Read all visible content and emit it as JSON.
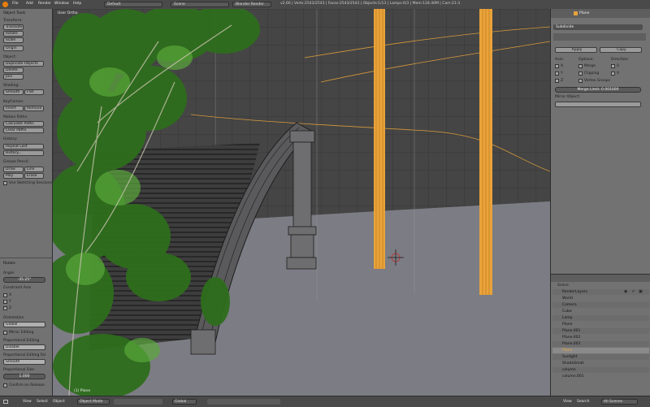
{
  "topbar": {
    "menus": [
      "File",
      "Add",
      "Render",
      "Window",
      "Help"
    ],
    "screen_layout": "Default",
    "scene": "Scene",
    "render_engine": "Blender Render",
    "info": "v2.66 | Verts:2543/2543 | Faces:2543/2543 | Objects:1/13 | Lamps:0/3 | Mem:118.40M | Cam:21:3"
  },
  "toolshelf": {
    "title": "Object Tools",
    "transform_hdr": "Transform:",
    "transform": [
      "Translate",
      "Rotate",
      "Scale",
      "Origin"
    ],
    "object_hdr": "Object:",
    "object": [
      "Duplicate Objects",
      "Delete",
      "Join"
    ],
    "shading_hdr": "Shading:",
    "smooth": "Smooth",
    "flat": "Flat",
    "keyframes_hdr": "Keyframes:",
    "insert": "Insert",
    "remove": "Remove",
    "motion_hdr": "Motion Paths:",
    "motion": [
      "Calculate Paths",
      "Clear Paths"
    ],
    "history_hdr": "History:",
    "history": [
      "Repeat Last",
      "History..."
    ],
    "grease_hdr": "Grease Pencil:",
    "draw": "Draw",
    "line": "Line",
    "poly": "Poly",
    "erase": "Erase",
    "use_sketching": "Use Sketching Sessions",
    "rotate_hdr": "Rotate",
    "angle_lbl": "Angle:",
    "angle": "-35.25°",
    "constraint_hdr": "Constraint Axis",
    "axes": [
      "X",
      "Y",
      "Z"
    ],
    "orientation_hdr": "Orientation",
    "orientation": "Global",
    "mirror_editing": "Mirror Editing",
    "proportional_hdr": "Proportional Editing",
    "proportional": "Disable",
    "falloff_hdr": "Proportional Editing Fal",
    "falloff": "Smooth",
    "size_hdr": "Proportional Size",
    "size": "1.000",
    "confirm": "Confirm on Release"
  },
  "viewport": {
    "label": "User Ortho",
    "object_label": "(1) Plane"
  },
  "properties": {
    "object_name": "Plane",
    "modifier_name": "Subdivide",
    "apply": "Apply",
    "copy": "Copy",
    "axis_hdr": "Axis:",
    "options_hdr": "Options:",
    "direction_hdr": "Direction:",
    "axes": [
      "X",
      "Y",
      "Z"
    ],
    "options": [
      "Merge",
      "Clipping",
      "Vertex Groups"
    ],
    "directions": [
      "U",
      "V"
    ],
    "merge_limit": "Merge Limit: 0.001000",
    "mirror_object": "Mirror Object:"
  },
  "outliner": {
    "scene": "Scene",
    "items": [
      "RenderLayers",
      "World",
      "Camera",
      "Cube",
      "Lamp",
      "Plane",
      "Plane.001",
      "Plane.002",
      "Plane.003",
      "Plane",
      "Sunlight",
      "ShadeSmall",
      "column",
      "column.001"
    ]
  },
  "bottombar": {
    "view_menus": [
      "View",
      "Select",
      "Object"
    ],
    "mode": "Object Mode",
    "pivot": "Global",
    "layers": "All Scenes",
    "outliner_menus": [
      "View",
      "Search"
    ]
  },
  "colors": {
    "accent": "#e8a33a",
    "panel": "#727272",
    "viewport": "#7b7b82"
  }
}
